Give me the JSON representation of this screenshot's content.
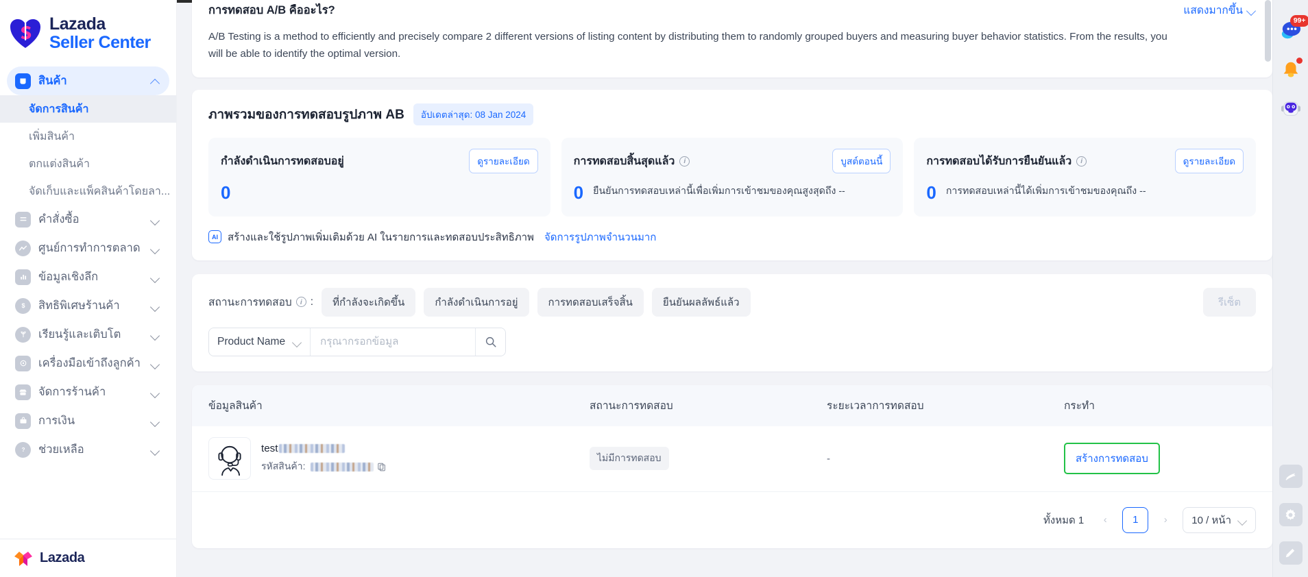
{
  "brand": {
    "line1": "Lazada",
    "line2": "Seller Center",
    "footer": "Lazada"
  },
  "sidebar": {
    "groups": [
      {
        "label": "สินค้า",
        "icon": "product-icon",
        "active": true,
        "sub": [
          {
            "label": "จัดการสินค้า",
            "active": true
          },
          {
            "label": "เพิ่มสินค้า",
            "active": false
          },
          {
            "label": "ตกแต่งสินค้า",
            "active": false
          },
          {
            "label": "จัดเก็บและแพ็คสินค้าโดยลา...",
            "active": false
          }
        ]
      },
      {
        "label": "คำสั่งซื้อ",
        "icon": "orders-icon",
        "active": false,
        "sub": []
      },
      {
        "label": "ศูนย์การทำการตลาด",
        "icon": "marketing-icon",
        "active": false,
        "sub": []
      },
      {
        "label": "ข้อมูลเชิงลึก",
        "icon": "insights-icon",
        "active": false,
        "sub": []
      },
      {
        "label": "สิทธิพิเศษร้านค้า",
        "icon": "benefits-icon",
        "active": false,
        "sub": []
      },
      {
        "label": "เรียนรู้และเติบโต",
        "icon": "grow-icon",
        "active": false,
        "sub": []
      },
      {
        "label": "เครื่องมือเข้าถึงลูกค้า",
        "icon": "reach-icon",
        "active": false,
        "sub": []
      },
      {
        "label": "จัดการร้านค้า",
        "icon": "store-icon",
        "active": false,
        "sub": []
      },
      {
        "label": "การเงิน",
        "icon": "finance-icon",
        "active": false,
        "sub": []
      },
      {
        "label": "ช่วยเหลือ",
        "icon": "help-icon",
        "active": false,
        "sub": []
      }
    ]
  },
  "intro": {
    "title": "การทดสอบ A/B คืออะไร?",
    "show_more": "แสดงมากขึ้น",
    "body": "A/B Testing is a method to efficiently and precisely compare 2 different versions of listing content by distributing them to randomly grouped buyers and measuring buyer behavior statistics. From the results, you will be able to identify the optimal version."
  },
  "overview": {
    "title": "ภาพรวมของการทดสอบรูปภาพ AB",
    "updated_chip": "อัปเดตล่าสุด: 08 Jan 2024",
    "stats": [
      {
        "name": "กำลังดำเนินการทดสอบอยู่",
        "has_info": false,
        "button": "ดูรายละเอียด",
        "value": "0",
        "desc": ""
      },
      {
        "name": "การทดสอบสิ้นสุดแล้ว",
        "has_info": true,
        "button": "บูสต์ตอนนี้",
        "value": "0",
        "desc": "ยืนยันการทดสอบเหล่านี้เพื่อเพิ่มการเข้าชมของคุณสูงสุดถึง --"
      },
      {
        "name": "การทดสอบได้รับการยืนยันแล้ว",
        "has_info": true,
        "button": "ดูรายละเอียด",
        "value": "0",
        "desc": "การทดสอบเหล่านี้ได้เพิ่มการเข้าชมของคุณถึง --"
      }
    ],
    "ai_badge": "AI",
    "ai_text": "สร้างและใช้รูปภาพเพิ่มเติมด้วย AI ในรายการและทดสอบประสิทธิภาพ",
    "ai_link": "จัดการรูปภาพจำนวนมาก"
  },
  "filters": {
    "status_label": "สถานะการทดสอบ",
    "status_colon": ":",
    "pills": [
      "ที่กำลังจะเกิดขึ้น",
      "กำลังดำเนินการอยู่",
      "การทดสอบเสร็จสิ้น",
      "ยืนยันผลลัพธ์แล้ว"
    ],
    "reset": "รีเซ็ต",
    "select_value": "Product Name",
    "search_placeholder": "กรุณากรอกข้อมูล",
    "search_value": ""
  },
  "table": {
    "headers": [
      "ข้อมูลสินค้า",
      "สถานะการทดสอบ",
      "ระยะเวลาการทดสอบ",
      "กระทำ"
    ],
    "rows": [
      {
        "name_prefix": "test",
        "sku_label": "รหัสสินค้า:",
        "status": "ไม่มีการทดสอบ",
        "duration": "-",
        "action": "สร้างการทดสอบ"
      }
    ]
  },
  "pagination": {
    "total": "ทั้งหมด 1",
    "prev": "‹",
    "current_page": "1",
    "next": "›",
    "page_size": "10 / หน้า"
  },
  "rail": {
    "chat_badge": "99+",
    "items": [
      "chat-icon",
      "bell-icon",
      "robot-icon",
      "note-icon",
      "gear-icon",
      "edit-icon"
    ]
  },
  "colors": {
    "accent": "#1a68ff",
    "green": "#22c247",
    "red": "#e8352e",
    "dark": "#1d2433"
  }
}
